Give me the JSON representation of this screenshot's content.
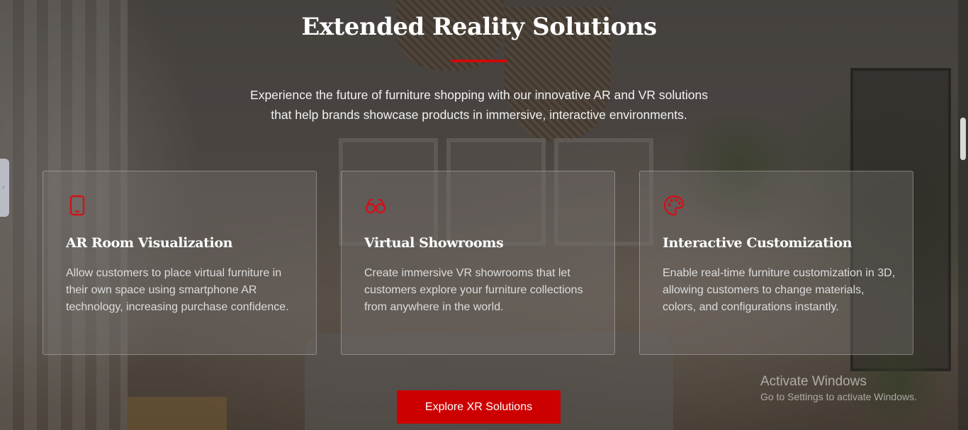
{
  "section": {
    "title": "Extended Reality Solutions",
    "subtitle_line1": "Experience the future of furniture shopping with our innovative AR and VR solutions",
    "subtitle_line2": "that help brands showcase products in immersive, interactive environments."
  },
  "cards": [
    {
      "icon": "smartphone-icon",
      "title": "AR Room Visualization",
      "text": "Allow customers to place virtual furniture in their own space using smartphone AR technology, increasing purchase confidence."
    },
    {
      "icon": "vr-glasses-icon",
      "title": "Virtual Showrooms",
      "text": "Create immersive VR showrooms that let customers explore your furniture collections from anywhere in the world."
    },
    {
      "icon": "palette-icon",
      "title": "Interactive Customization",
      "text": "Enable real-time furniture customization in 3D, allowing customers to change materials, colors, and configurations instantly."
    }
  ],
  "cta": {
    "label": "Explore XR Solutions"
  },
  "watermark": {
    "title": "Activate Windows",
    "subtitle": "Go to Settings to activate Windows."
  },
  "colors": {
    "accent": "#cc0000",
    "card_border": "#ffffff47",
    "icon": "#d0121b"
  }
}
